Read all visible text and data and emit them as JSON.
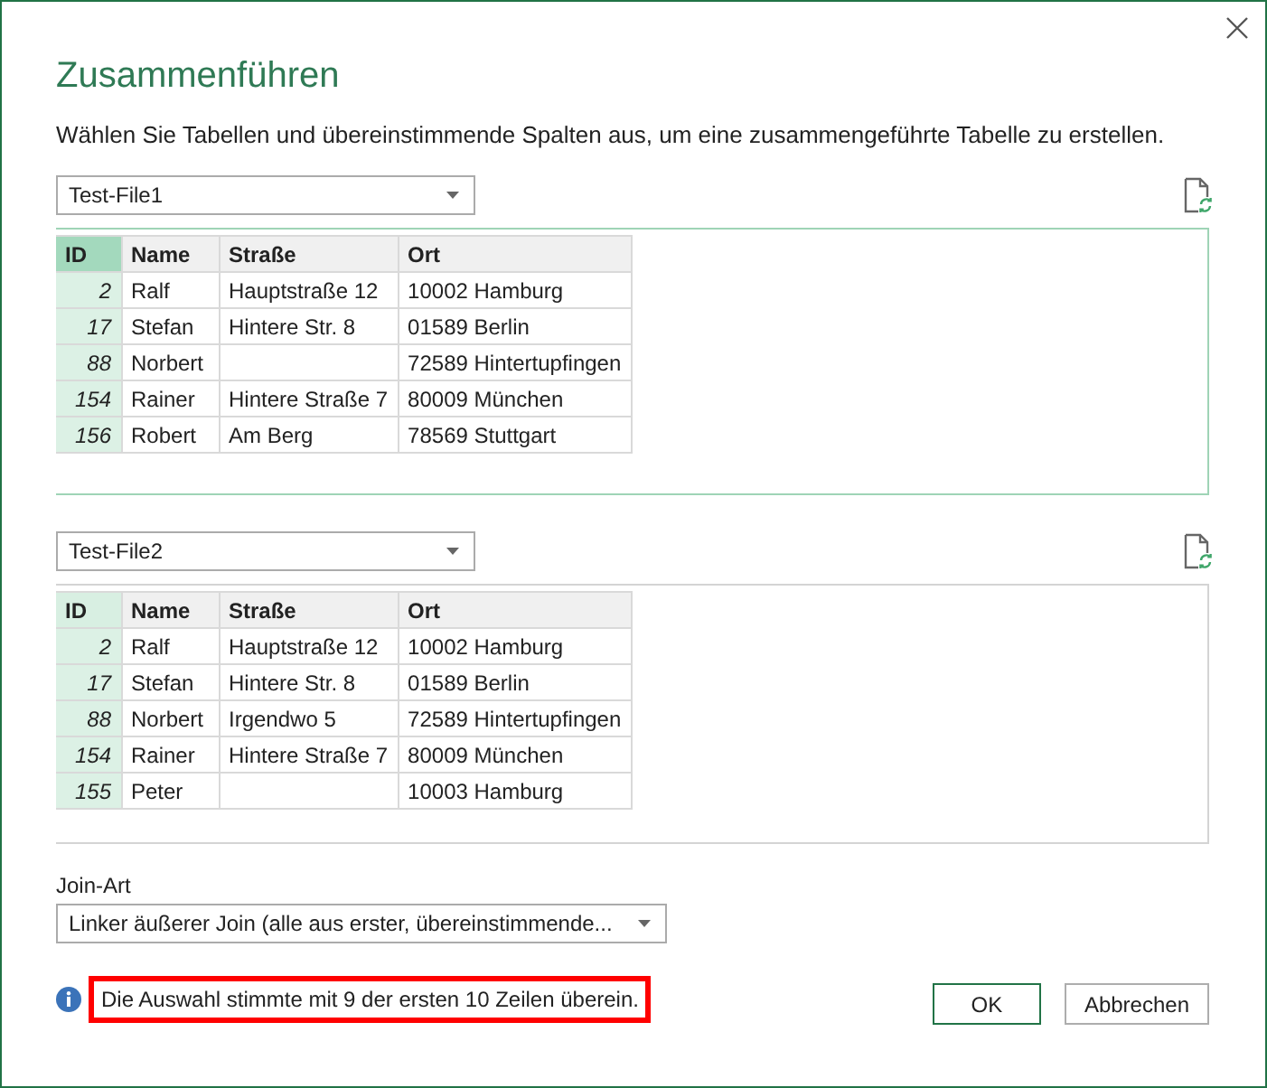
{
  "dialog": {
    "title": "Zusammenführen",
    "description": "Wählen Sie Tabellen und übereinstimmende Spalten aus, um eine zusammengeführte Tabelle zu erstellen.",
    "tables": [
      {
        "source": "Test-File1",
        "focused": true,
        "columns": [
          {
            "label": "ID",
            "selected": true
          },
          {
            "label": "Name",
            "selected": false
          },
          {
            "label": "Straße",
            "selected": false
          },
          {
            "label": "Ort",
            "selected": false
          }
        ],
        "rows": [
          [
            "2",
            "Ralf",
            "Hauptstraße 12",
            "10002 Hamburg"
          ],
          [
            "17",
            "Stefan",
            "Hintere Str. 8",
            "01589 Berlin"
          ],
          [
            "88",
            "Norbert",
            null,
            "72589 Hintertupfingen"
          ],
          [
            "154",
            "Rainer",
            "Hintere Straße 7",
            "80009 München"
          ],
          [
            "156",
            "Robert",
            "Am Berg",
            "78569 Stuttgart"
          ]
        ]
      },
      {
        "source": "Test-File2",
        "focused": false,
        "columns": [
          {
            "label": "ID",
            "selected": true
          },
          {
            "label": "Name",
            "selected": false
          },
          {
            "label": "Straße",
            "selected": false
          },
          {
            "label": "Ort",
            "selected": false
          }
        ],
        "rows": [
          [
            "2",
            "Ralf",
            "Hauptstraße 12",
            "10002 Hamburg"
          ],
          [
            "17",
            "Stefan",
            "Hintere Str. 8",
            "01589 Berlin"
          ],
          [
            "88",
            "Norbert",
            "Irgendwo 5",
            "72589 Hintertupfingen"
          ],
          [
            "154",
            "Rainer",
            "Hintere Straße 7",
            "80009 München"
          ],
          [
            "155",
            "Peter",
            null,
            "10003 Hamburg"
          ]
        ]
      }
    ],
    "join": {
      "label": "Join-Art",
      "value": "Linker äußerer Join (alle aus erster, übereinstimmende..."
    },
    "message": {
      "text": "Die Auswahl stimmte mit 9 der ersten 10 Zeilen überein.",
      "highlighted": true
    },
    "buttons": [
      {
        "label": "OK",
        "kind": "primary"
      },
      {
        "label": "Abbrechen",
        "kind": "secondary"
      }
    ]
  }
}
